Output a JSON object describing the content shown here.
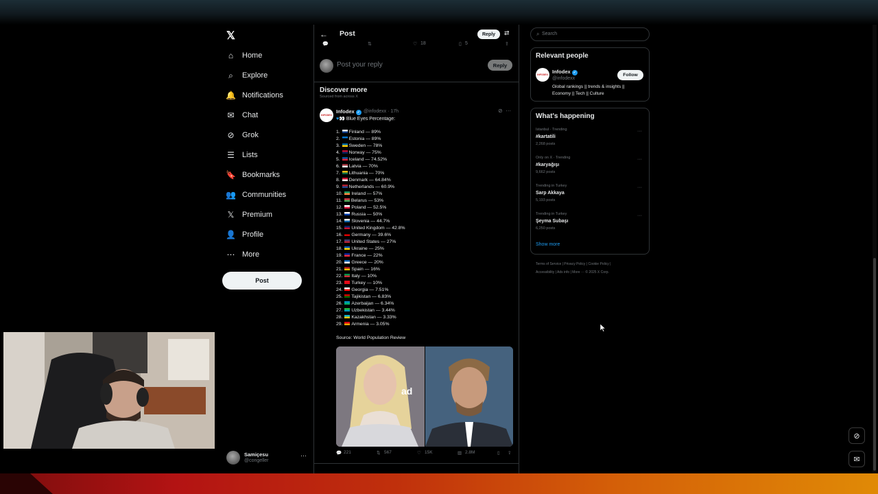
{
  "nav": {
    "items": [
      {
        "label": "Home",
        "icon": "home-icon",
        "glyph": "⌂"
      },
      {
        "label": "Explore",
        "icon": "search-icon",
        "glyph": "⌕"
      },
      {
        "label": "Notifications",
        "icon": "bell-icon",
        "glyph": "🔔"
      },
      {
        "label": "Chat",
        "icon": "mail-icon",
        "glyph": "✉"
      },
      {
        "label": "Grok",
        "icon": "grok-icon",
        "glyph": "⊘"
      },
      {
        "label": "Lists",
        "icon": "list-icon",
        "glyph": "☰"
      },
      {
        "label": "Bookmarks",
        "icon": "bookmark-icon",
        "glyph": "🔖"
      },
      {
        "label": "Communities",
        "icon": "communities-icon",
        "glyph": "👥"
      },
      {
        "label": "Premium",
        "icon": "x-logo-icon",
        "glyph": "𝕏"
      },
      {
        "label": "Profile",
        "icon": "person-icon",
        "glyph": "👤"
      },
      {
        "label": "More",
        "icon": "more-circle-icon",
        "glyph": "⋯"
      }
    ],
    "post_label": "Post"
  },
  "account": {
    "name": "Samiçesu",
    "handle": "@congeller"
  },
  "header": {
    "title": "Post",
    "reply_label": "Reply"
  },
  "mini_actions": {
    "likes": "18",
    "bookmarks": "5"
  },
  "reply_box": {
    "placeholder": "Post your reply",
    "button": "Reply"
  },
  "discover": {
    "title": "Discover more",
    "subtitle": "Sourced from across X"
  },
  "tweet": {
    "author": "Infodex",
    "avatar_text": "INFODEX",
    "meta": "@infodexx · 17h",
    "headline": "Blue Eyes Percentage:",
    "items": [
      {
        "text": "1. Finland — 89%",
        "flag": [
          "#ffffff",
          "#003580"
        ]
      },
      {
        "text": "2. Estonia — 89%",
        "flag": [
          "#0072ce",
          "#000000"
        ]
      },
      {
        "text": "3. Sweden — 78%",
        "flag": [
          "#006aa7",
          "#fecc00"
        ]
      },
      {
        "text": "4. Norway — 75%",
        "flag": [
          "#ba0c2f",
          "#00205b"
        ]
      },
      {
        "text": "5. Iceland — 74.52%",
        "flag": [
          "#02529c",
          "#dc1e35"
        ]
      },
      {
        "text": "6. Latvia — 70%",
        "flag": [
          "#9e3039",
          "#ffffff"
        ]
      },
      {
        "text": "7. Lithuania — 70%",
        "flag": [
          "#fdb913",
          "#006a44"
        ]
      },
      {
        "text": "8. Denmark — 64.84%",
        "flag": [
          "#c8102e",
          "#ffffff"
        ]
      },
      {
        "text": "9. Netherlands — 60.9%",
        "flag": [
          "#ae1c28",
          "#21468b"
        ]
      },
      {
        "text": "10. Ireland — 57%",
        "flag": [
          "#169b62",
          "#ff883e"
        ]
      },
      {
        "text": "11. Belarus — 53%",
        "flag": [
          "#c8313e",
          "#4aa657"
        ]
      },
      {
        "text": "12. Poland — 52.5%",
        "flag": [
          "#ffffff",
          "#dc143c"
        ]
      },
      {
        "text": "13. Russia — 50%",
        "flag": [
          "#ffffff",
          "#0039a6"
        ]
      },
      {
        "text": "14. Slovenia — 44.7%",
        "flag": [
          "#ffffff",
          "#005da4"
        ]
      },
      {
        "text": "15. United Kingdom — 42.8%",
        "flag": [
          "#012169",
          "#c8102e"
        ]
      },
      {
        "text": "16. Germany — 39.6%",
        "flag": [
          "#000000",
          "#dd0000"
        ]
      },
      {
        "text": "17. United States — 27%",
        "flag": [
          "#3c3b6e",
          "#b22234"
        ]
      },
      {
        "text": "18. Ukraine — 25%",
        "flag": [
          "#0057b7",
          "#ffd700"
        ]
      },
      {
        "text": "19. France — 22%",
        "flag": [
          "#002395",
          "#ed2939"
        ]
      },
      {
        "text": "20. Greece — 20%",
        "flag": [
          "#0d5eaf",
          "#ffffff"
        ]
      },
      {
        "text": "21. Spain — 16%",
        "flag": [
          "#aa151b",
          "#f1bf00"
        ]
      },
      {
        "text": "22. Italy — 10%",
        "flag": [
          "#009246",
          "#ce2b37"
        ]
      },
      {
        "text": "23. Turkey — 10%",
        "flag": [
          "#e30a17",
          "#e30a17"
        ]
      },
      {
        "text": "24. Georgia — 7.51%",
        "flag": [
          "#ffffff",
          "#ff0000"
        ]
      },
      {
        "text": "25. Tajikistan — 6.83%",
        "flag": [
          "#cc0000",
          "#006600"
        ]
      },
      {
        "text": "26. Azerbaijan — 6.34%",
        "flag": [
          "#0092bc",
          "#00af66"
        ]
      },
      {
        "text": "27. Uzbekistan — 3.44%",
        "flag": [
          "#1eb53a",
          "#0099b5"
        ]
      },
      {
        "text": "28. Kazakhstan — 3.33%",
        "flag": [
          "#00afca",
          "#fec50c"
        ]
      },
      {
        "text": "29. Armenia — 3.05%",
        "flag": [
          "#d90012",
          "#f2a800"
        ]
      }
    ],
    "source": "Source: World Population Review",
    "actions": {
      "replies": "221",
      "reposts": "567",
      "likes": "15K",
      "views": "2.8M"
    }
  },
  "search": {
    "placeholder": "Search"
  },
  "relevant": {
    "title": "Relevant people",
    "name": "Infodex",
    "handle": "@infodexx",
    "bio": "Global rankings || trends & insights || Economy || Tech || Culture",
    "follow": "Follow"
  },
  "happening": {
    "title": "What's happening",
    "trends": [
      {
        "meta": "Istanbul · Trending",
        "name": "#kartatili",
        "posts": "2,268 posts"
      },
      {
        "meta": "Only on X · Trending",
        "name": "#karyağışı",
        "posts": "9,662 posts"
      },
      {
        "meta": "Trending in Turkey",
        "name": "Sarp Akkaya",
        "posts": "5,193 posts"
      },
      {
        "meta": "Trending in Turkey",
        "name": "Şeyma Subaşı",
        "posts": "6,250 posts"
      }
    ],
    "show_more": "Show more"
  },
  "footer": {
    "line1": "Terms of Service  |  Privacy Policy  |  Cookie Policy  |",
    "line2": "Accessibility  |  Ads info  |  More ···  © 2025 X Corp."
  }
}
